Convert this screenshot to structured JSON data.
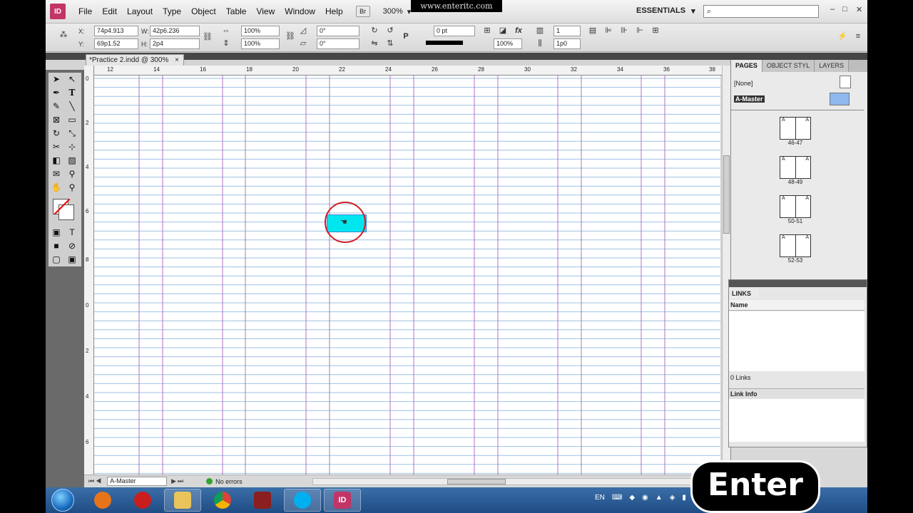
{
  "menubar": {
    "app_icon": "ID",
    "items": [
      "File",
      "Edit",
      "Layout",
      "Type",
      "Object",
      "Table",
      "View",
      "Window",
      "Help"
    ],
    "bridge": "Br",
    "zoom": "300%",
    "workspace": "ESSENTIALS",
    "watermark": "www.enteritc.com",
    "window_controls": [
      "–",
      "□",
      "✕"
    ]
  },
  "control": {
    "x_label": "X:",
    "x_value": "74p4.913",
    "y_label": "Y:",
    "y_value": "69p1.52",
    "w_label": "W:",
    "w_value": "42p6.236",
    "h_label": "H:",
    "h_value": "2p4",
    "scale_x": "100%",
    "scale_y": "100%",
    "rotate": "0°",
    "shear": "0°",
    "stroke_weight": "0 pt",
    "opacity": "100%",
    "columns": "1",
    "gutter": "1p0"
  },
  "doc_tab": {
    "title": "*Practice 2.indd @ 300%",
    "close": "×"
  },
  "ruler": {
    "top_labels": [
      "12",
      "14",
      "16",
      "18",
      "20",
      "22",
      "24",
      "26",
      "28",
      "30",
      "32",
      "34",
      "36",
      "38"
    ],
    "left_labels": [
      "0",
      "2",
      "4",
      "6",
      "8",
      "0",
      "2",
      "4",
      "6"
    ]
  },
  "status": {
    "page": "A-Master",
    "preflight": "No errors"
  },
  "pages_panel": {
    "tabs": [
      "PAGES",
      "OBJECT STYL",
      "LAYERS"
    ],
    "masters": [
      "[None]",
      "A-Master"
    ],
    "spreads": [
      {
        "label": "46-47",
        "a": "A"
      },
      {
        "label": "48-49",
        "a": "A"
      },
      {
        "label": "50-51",
        "a": "A"
      },
      {
        "label": "52-53",
        "a": "A"
      }
    ]
  },
  "links_panel": {
    "tab": "LINKS",
    "column": "Name",
    "count": "0 Links",
    "info": "Link Info"
  },
  "taskbar": {
    "tray_lang": "EN",
    "indesign": "ID"
  },
  "brand": "Enter",
  "colors": {
    "frame_fill": "#00e6ee",
    "ring": "#d21c25",
    "accent": "#c23567"
  }
}
